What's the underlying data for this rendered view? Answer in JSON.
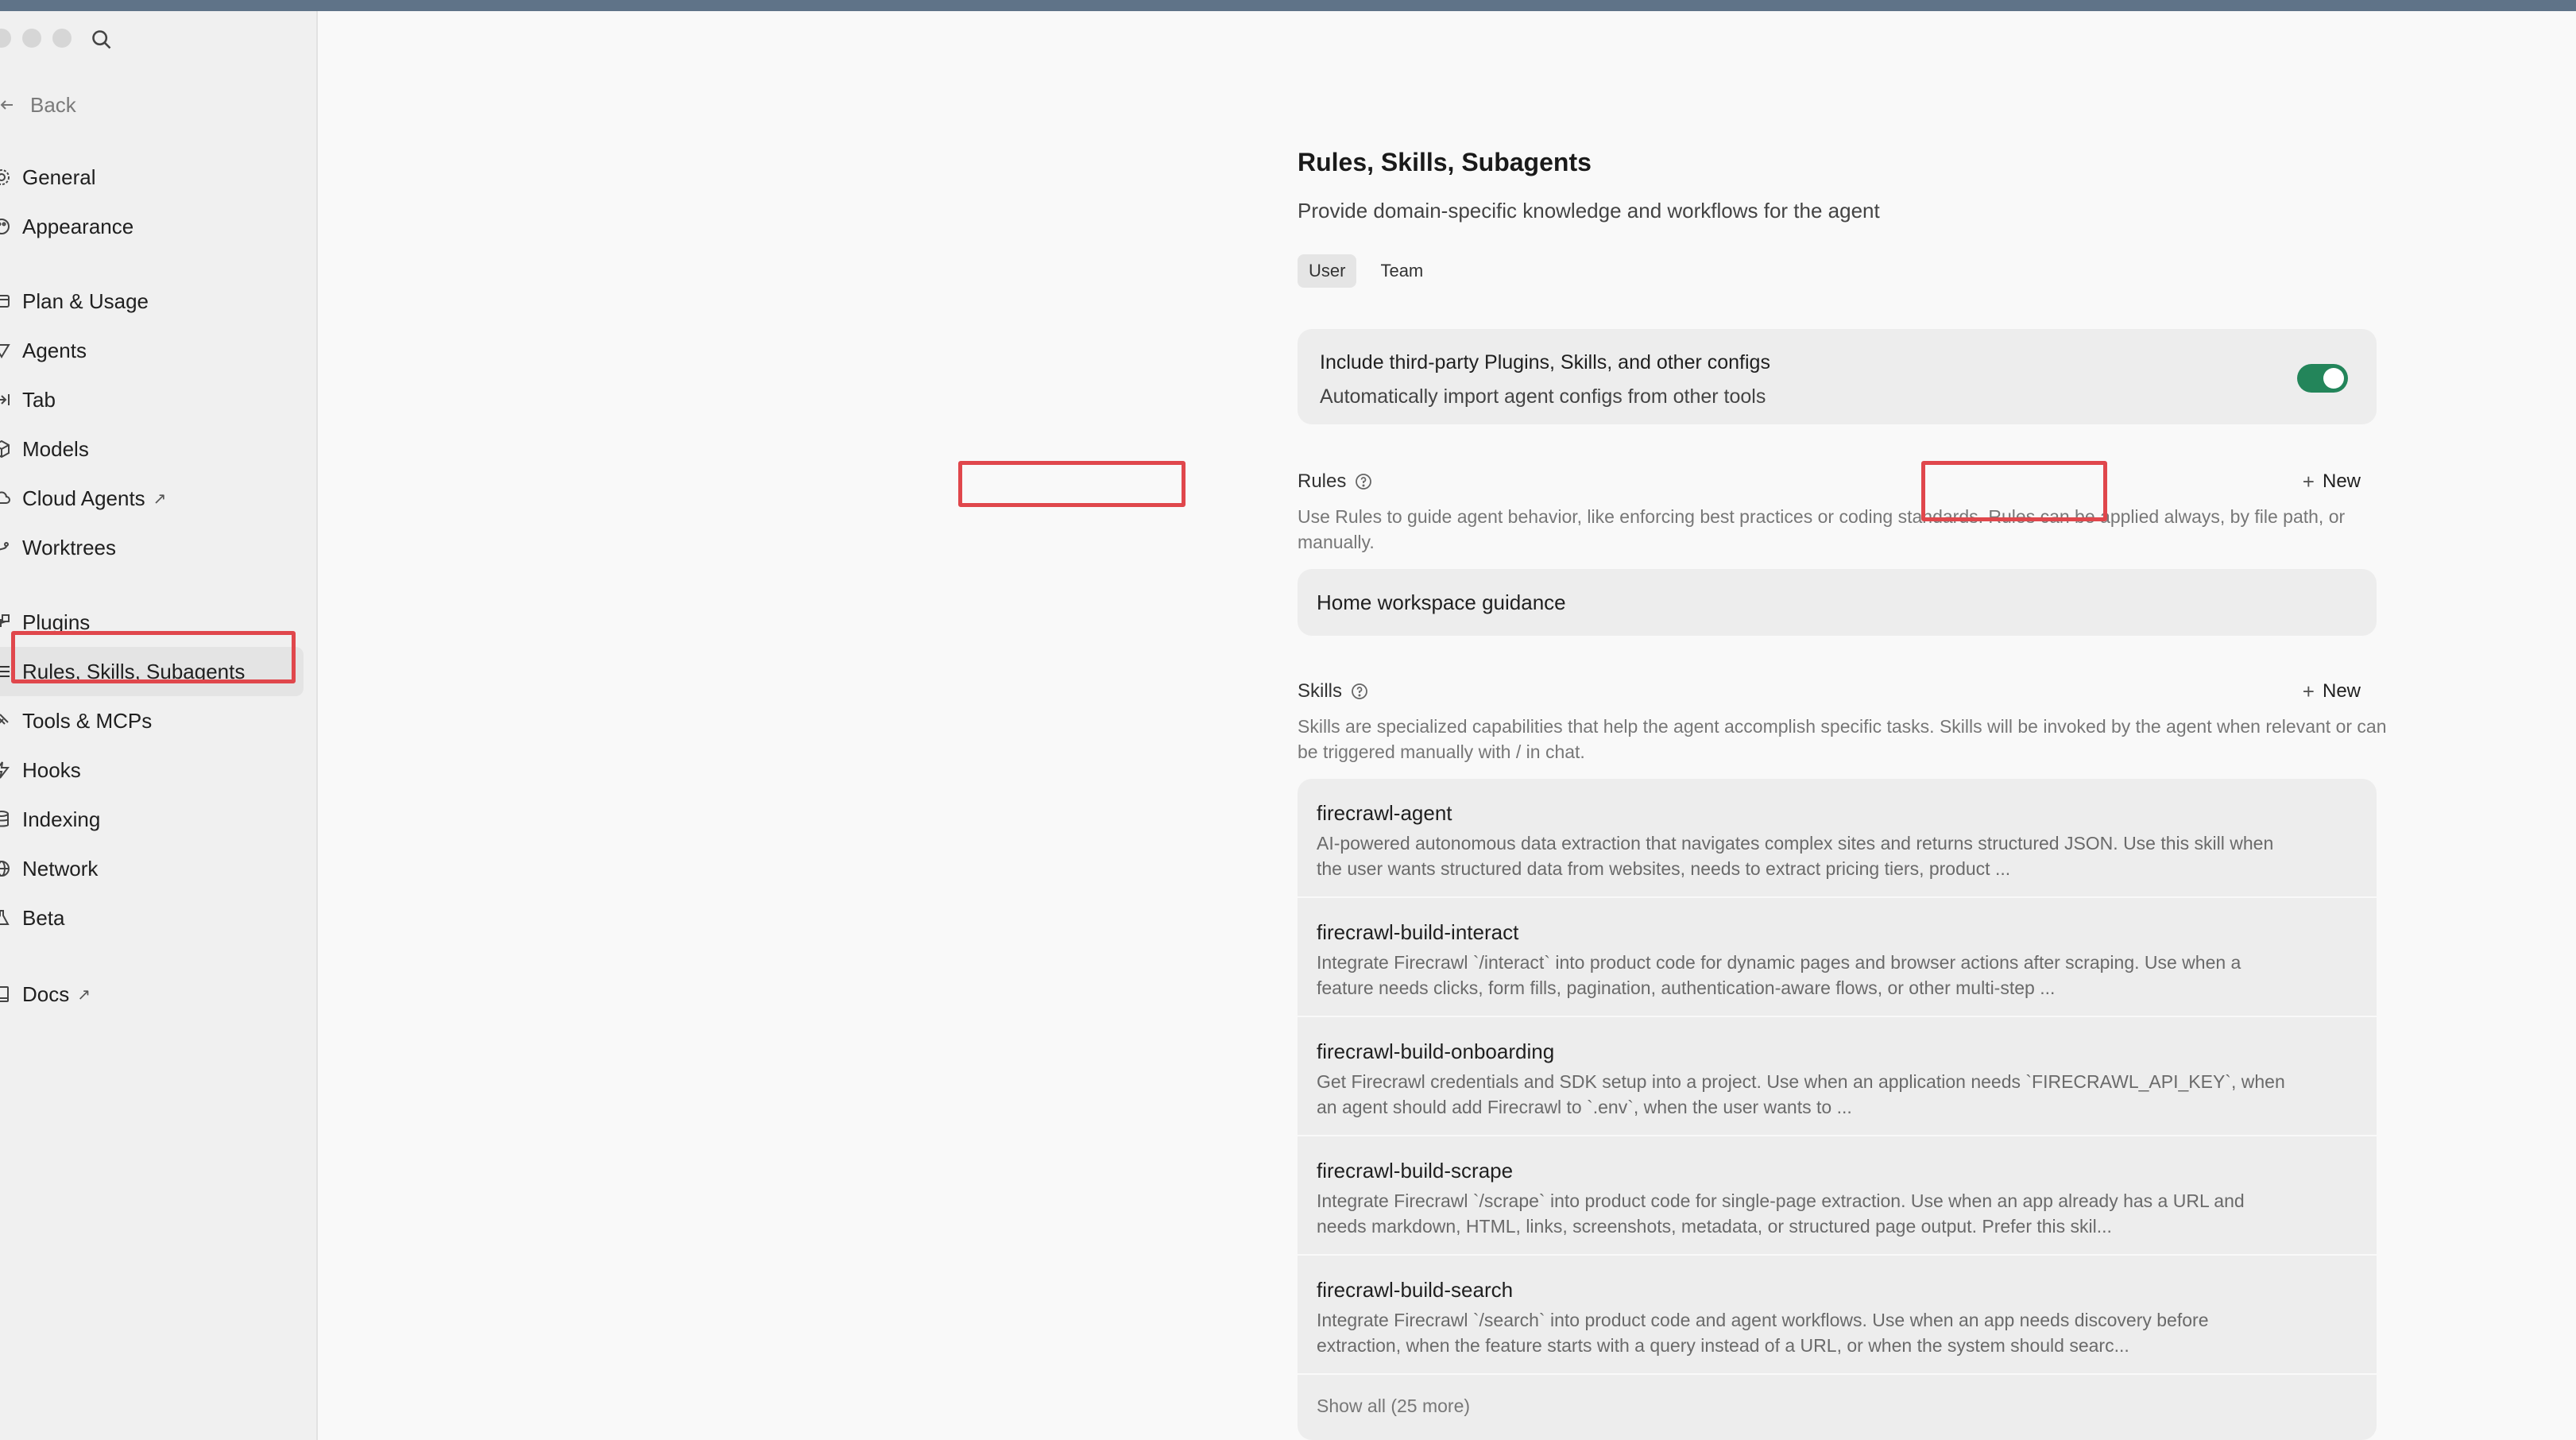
{
  "sidebar": {
    "back_label": "Back",
    "groups": [
      [
        {
          "label": "General",
          "icon": "gear-icon"
        },
        {
          "label": "Appearance",
          "icon": "palette-icon"
        }
      ],
      [
        {
          "label": "Plan & Usage",
          "icon": "card-icon"
        },
        {
          "label": "Agents",
          "icon": "infinity-icon"
        },
        {
          "label": "Tab",
          "icon": "tab-arrow-icon"
        },
        {
          "label": "Models",
          "icon": "cube-icon"
        },
        {
          "label": "Cloud Agents",
          "icon": "cloud-icon",
          "external": "↗"
        },
        {
          "label": "Worktrees",
          "icon": "branch-icon"
        }
      ],
      [
        {
          "label": "Plugins",
          "icon": "plugin-icon"
        },
        {
          "label": "Rules, Skills, Subagents",
          "icon": "list-icon",
          "active": true
        },
        {
          "label": "Tools & MCPs",
          "icon": "tools-icon"
        },
        {
          "label": "Hooks",
          "icon": "bolt-icon"
        },
        {
          "label": "Indexing",
          "icon": "database-icon"
        },
        {
          "label": "Network",
          "icon": "globe-icon"
        },
        {
          "label": "Beta",
          "icon": "flask-icon"
        }
      ],
      [
        {
          "label": "Docs",
          "icon": "book-icon",
          "external": "↗"
        }
      ]
    ]
  },
  "page": {
    "title": "Rules, Skills, Subagents",
    "subtitle": "Provide domain-specific knowledge and workflows for the agent",
    "tabs": [
      {
        "label": "User",
        "active": true
      },
      {
        "label": "Team",
        "active": false
      }
    ]
  },
  "third_party": {
    "title": "Include third-party Plugins, Skills, and other configs",
    "description": "Automatically import agent configs from other tools",
    "enabled": true,
    "accent": "#23855a"
  },
  "rules": {
    "heading": "Rules",
    "new_label": "New",
    "description": "Use Rules to guide agent behavior, like enforcing best practices or coding standards. Rules can be applied always, by file path, or manually.",
    "items": [
      "Home workspace guidance"
    ]
  },
  "skills": {
    "heading": "Skills",
    "new_label": "New",
    "description": "Skills are specialized capabilities that help the agent accomplish specific tasks. Skills will be invoked by the agent when relevant or can be triggered manually with / in chat.",
    "items": [
      {
        "name": "firecrawl-agent",
        "description": "AI-powered autonomous data extraction that navigates complex sites and returns structured JSON. Use this skill when the user wants structured data from websites, needs to extract pricing tiers, product ..."
      },
      {
        "name": "firecrawl-build-interact",
        "description": "Integrate Firecrawl `/interact` into product code for dynamic pages and browser actions after scraping. Use when a feature needs clicks, form fills, pagination, authentication-aware flows, or other multi-step ..."
      },
      {
        "name": "firecrawl-build-onboarding",
        "description": "Get Firecrawl credentials and SDK setup into a project. Use when an application needs `FIRECRAWL_API_KEY`, when an agent should add Firecrawl to `.env`, when the user wants to ..."
      },
      {
        "name": "firecrawl-build-scrape",
        "description": "Integrate Firecrawl `/scrape` into product code for single-page extraction. Use when an app already has a URL and needs markdown, HTML, links, screenshots, metadata, or structured page output. Prefer this skil..."
      },
      {
        "name": "firecrawl-build-search",
        "description": "Integrate Firecrawl `/search` into product code and agent workflows. Use when an app needs discovery before extraction, when the feature starts with a query instead of a URL, or when the system should searc..."
      }
    ],
    "show_all_label": "Show all (25 more)"
  },
  "highlight_color": "#e0474c"
}
